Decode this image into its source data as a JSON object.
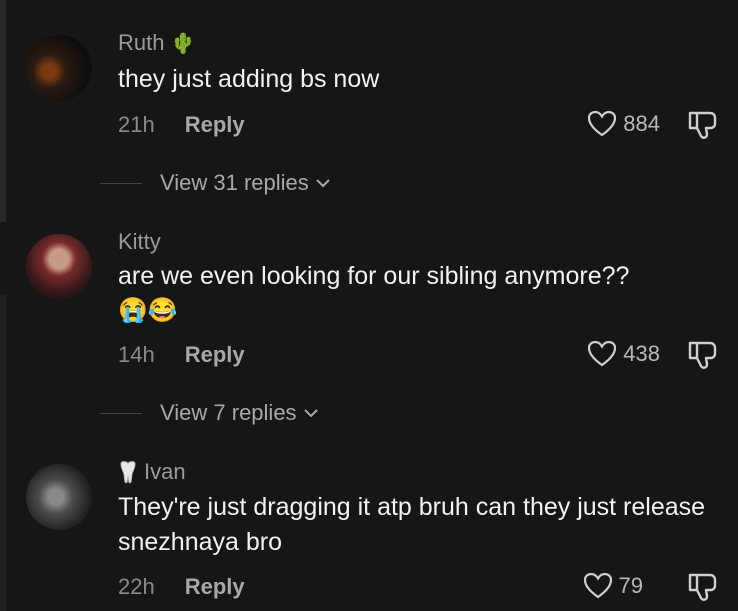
{
  "comments": [
    {
      "username": "Ruth",
      "username_emoji": "🌵",
      "text": "they just adding bs now",
      "time": "21h",
      "reply_label": "Reply",
      "likes": "884",
      "view_replies": "View 31 replies"
    },
    {
      "username": "Kitty",
      "text": "are we even looking for our sibling anymore??",
      "text_emojis": "😭😂",
      "time": "14h",
      "reply_label": "Reply",
      "likes": "438",
      "view_replies": "View 7 replies"
    },
    {
      "username": "Ivan",
      "username_icon": "tooth-icon",
      "text": "They're just dragging it atp bruh can they just release snezhnaya bro",
      "time": "22h",
      "reply_label": "Reply",
      "likes": "79"
    }
  ],
  "colors": {
    "background": "#161616",
    "text": "#f2f2f2",
    "muted": "#8a8a8a"
  }
}
